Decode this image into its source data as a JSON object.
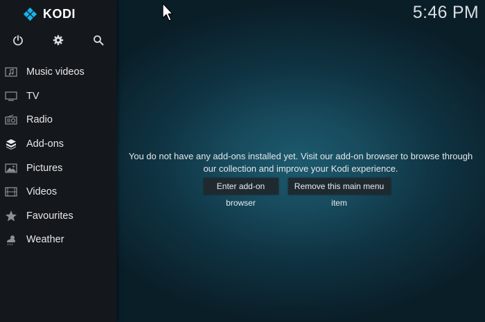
{
  "app": {
    "name": "KODI"
  },
  "clock": "5:46 PM",
  "top_icons": [
    "power-icon",
    "gear-icon",
    "search-icon"
  ],
  "menu": {
    "items": [
      {
        "label": "Music videos",
        "icon": "music-video-icon"
      },
      {
        "label": "TV",
        "icon": "tv-icon"
      },
      {
        "label": "Radio",
        "icon": "radio-icon"
      },
      {
        "label": "Add-ons",
        "icon": "addons-box-icon"
      },
      {
        "label": "Pictures",
        "icon": "pictures-icon"
      },
      {
        "label": "Videos",
        "icon": "film-icon"
      },
      {
        "label": "Favourites",
        "icon": "star-icon"
      },
      {
        "label": "Weather",
        "icon": "weather-icon"
      }
    ]
  },
  "main": {
    "message_line1": "You do not have any add-ons installed yet. Visit our add-on browser to browse through",
    "message_line2": "our collection and improve your Kodi experience.",
    "enter_button": "Enter add-on browser",
    "remove_button": "Remove this main menu item"
  },
  "colors": {
    "sidebar": "#14181c",
    "accent": "#12b2e7",
    "background": "#174a5c"
  }
}
